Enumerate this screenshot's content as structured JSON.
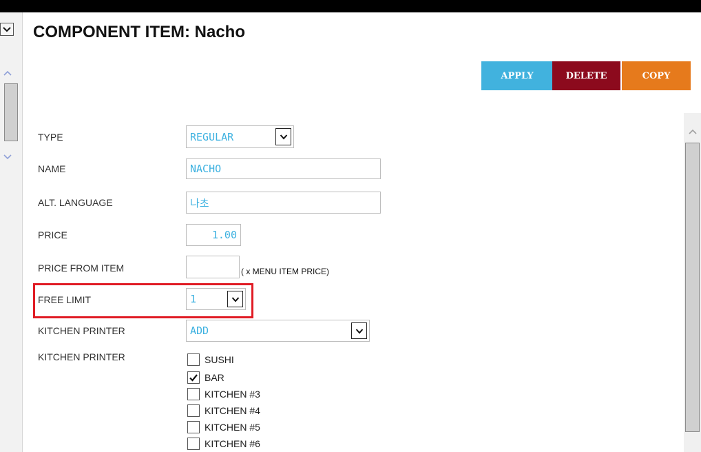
{
  "page": {
    "title": "COMPONENT ITEM: Nacho"
  },
  "buttons": {
    "apply": "APPLY",
    "delete": "DELETE",
    "copy": "COPY"
  },
  "form": {
    "type_label": "TYPE",
    "type_value": "REGULAR",
    "name_label": "NAME",
    "name_value": "NACHO",
    "alt_language_label": "ALT. LANGUAGE",
    "alt_language_value": "나초",
    "price_label": "PRICE",
    "price_value": "1.00",
    "price_from_item_label": "PRICE FROM ITEM",
    "price_from_item_value": "",
    "price_from_item_hint": "( x MENU ITEM PRICE)",
    "free_limit_label": "FREE LIMIT",
    "free_limit_value": "1",
    "kitchen_printer_label": "KITCHEN PRINTER",
    "kitchen_printer_value": "ADD",
    "kitchen_printers_label": "KITCHEN PRINTER",
    "printers": [
      {
        "label": "SUSHI",
        "checked": false
      },
      {
        "label": "BAR",
        "checked": true
      },
      {
        "label": "KITCHEN #3",
        "checked": false
      },
      {
        "label": "KITCHEN #4",
        "checked": false
      },
      {
        "label": "KITCHEN #5",
        "checked": false
      },
      {
        "label": "KITCHEN #6",
        "checked": false
      }
    ]
  },
  "colors": {
    "apply": "#41b2de",
    "delete": "#8c0a1d",
    "copy": "#e67a1c",
    "field_text": "#3db1e0",
    "highlight": "#e01b24"
  },
  "icons": {
    "collapse": "chevron-down-icon",
    "scroll_up": "chevron-up-icon",
    "scroll_down": "chevron-down-icon",
    "checkbox_checked": "checkmark-icon"
  }
}
